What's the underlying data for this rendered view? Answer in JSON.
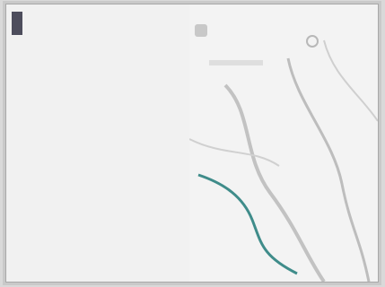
{
  "header": {
    "title": "",
    "subtitle": ""
  },
  "content": {
    "heading": "",
    "paragraphs": [
      "",
      "",
      "",
      "",
      "",
      ""
    ]
  },
  "colors": {
    "river": "#3f8c8a",
    "road": "#b8b8b8",
    "accent": "#1f2360"
  },
  "icons": [
    "app-logo-icon",
    "map-tool-icon",
    "search-icon"
  ]
}
